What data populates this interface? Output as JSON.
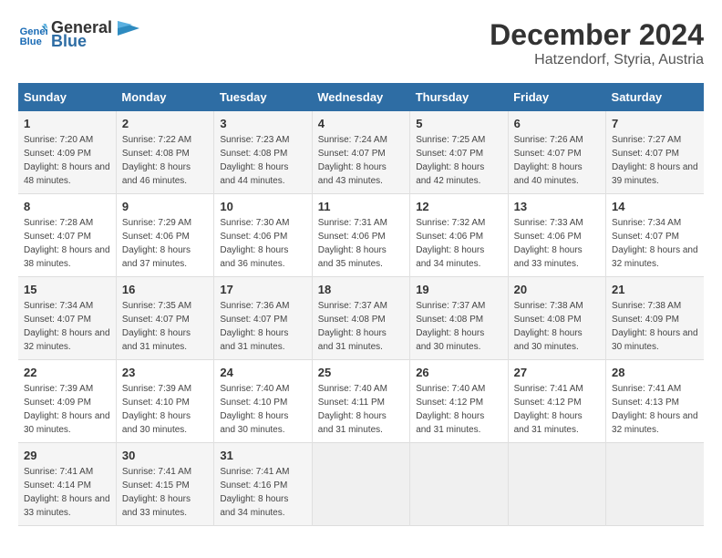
{
  "logo": {
    "line1": "General",
    "line2": "Blue"
  },
  "title": "December 2024",
  "location": "Hatzendorf, Styria, Austria",
  "weekdays": [
    "Sunday",
    "Monday",
    "Tuesday",
    "Wednesday",
    "Thursday",
    "Friday",
    "Saturday"
  ],
  "weeks": [
    [
      {
        "day": "1",
        "sunrise": "7:20 AM",
        "sunset": "4:09 PM",
        "daylight": "8 hours and 48 minutes."
      },
      {
        "day": "2",
        "sunrise": "7:22 AM",
        "sunset": "4:08 PM",
        "daylight": "8 hours and 46 minutes."
      },
      {
        "day": "3",
        "sunrise": "7:23 AM",
        "sunset": "4:08 PM",
        "daylight": "8 hours and 44 minutes."
      },
      {
        "day": "4",
        "sunrise": "7:24 AM",
        "sunset": "4:07 PM",
        "daylight": "8 hours and 43 minutes."
      },
      {
        "day": "5",
        "sunrise": "7:25 AM",
        "sunset": "4:07 PM",
        "daylight": "8 hours and 42 minutes."
      },
      {
        "day": "6",
        "sunrise": "7:26 AM",
        "sunset": "4:07 PM",
        "daylight": "8 hours and 40 minutes."
      },
      {
        "day": "7",
        "sunrise": "7:27 AM",
        "sunset": "4:07 PM",
        "daylight": "8 hours and 39 minutes."
      }
    ],
    [
      {
        "day": "8",
        "sunrise": "7:28 AM",
        "sunset": "4:07 PM",
        "daylight": "8 hours and 38 minutes."
      },
      {
        "day": "9",
        "sunrise": "7:29 AM",
        "sunset": "4:06 PM",
        "daylight": "8 hours and 37 minutes."
      },
      {
        "day": "10",
        "sunrise": "7:30 AM",
        "sunset": "4:06 PM",
        "daylight": "8 hours and 36 minutes."
      },
      {
        "day": "11",
        "sunrise": "7:31 AM",
        "sunset": "4:06 PM",
        "daylight": "8 hours and 35 minutes."
      },
      {
        "day": "12",
        "sunrise": "7:32 AM",
        "sunset": "4:06 PM",
        "daylight": "8 hours and 34 minutes."
      },
      {
        "day": "13",
        "sunrise": "7:33 AM",
        "sunset": "4:06 PM",
        "daylight": "8 hours and 33 minutes."
      },
      {
        "day": "14",
        "sunrise": "7:34 AM",
        "sunset": "4:07 PM",
        "daylight": "8 hours and 32 minutes."
      }
    ],
    [
      {
        "day": "15",
        "sunrise": "7:34 AM",
        "sunset": "4:07 PM",
        "daylight": "8 hours and 32 minutes."
      },
      {
        "day": "16",
        "sunrise": "7:35 AM",
        "sunset": "4:07 PM",
        "daylight": "8 hours and 31 minutes."
      },
      {
        "day": "17",
        "sunrise": "7:36 AM",
        "sunset": "4:07 PM",
        "daylight": "8 hours and 31 minutes."
      },
      {
        "day": "18",
        "sunrise": "7:37 AM",
        "sunset": "4:08 PM",
        "daylight": "8 hours and 31 minutes."
      },
      {
        "day": "19",
        "sunrise": "7:37 AM",
        "sunset": "4:08 PM",
        "daylight": "8 hours and 30 minutes."
      },
      {
        "day": "20",
        "sunrise": "7:38 AM",
        "sunset": "4:08 PM",
        "daylight": "8 hours and 30 minutes."
      },
      {
        "day": "21",
        "sunrise": "7:38 AM",
        "sunset": "4:09 PM",
        "daylight": "8 hours and 30 minutes."
      }
    ],
    [
      {
        "day": "22",
        "sunrise": "7:39 AM",
        "sunset": "4:09 PM",
        "daylight": "8 hours and 30 minutes."
      },
      {
        "day": "23",
        "sunrise": "7:39 AM",
        "sunset": "4:10 PM",
        "daylight": "8 hours and 30 minutes."
      },
      {
        "day": "24",
        "sunrise": "7:40 AM",
        "sunset": "4:10 PM",
        "daylight": "8 hours and 30 minutes."
      },
      {
        "day": "25",
        "sunrise": "7:40 AM",
        "sunset": "4:11 PM",
        "daylight": "8 hours and 31 minutes."
      },
      {
        "day": "26",
        "sunrise": "7:40 AM",
        "sunset": "4:12 PM",
        "daylight": "8 hours and 31 minutes."
      },
      {
        "day": "27",
        "sunrise": "7:41 AM",
        "sunset": "4:12 PM",
        "daylight": "8 hours and 31 minutes."
      },
      {
        "day": "28",
        "sunrise": "7:41 AM",
        "sunset": "4:13 PM",
        "daylight": "8 hours and 32 minutes."
      }
    ],
    [
      {
        "day": "29",
        "sunrise": "7:41 AM",
        "sunset": "4:14 PM",
        "daylight": "8 hours and 33 minutes."
      },
      {
        "day": "30",
        "sunrise": "7:41 AM",
        "sunset": "4:15 PM",
        "daylight": "8 hours and 33 minutes."
      },
      {
        "day": "31",
        "sunrise": "7:41 AM",
        "sunset": "4:16 PM",
        "daylight": "8 hours and 34 minutes."
      },
      null,
      null,
      null,
      null
    ]
  ]
}
